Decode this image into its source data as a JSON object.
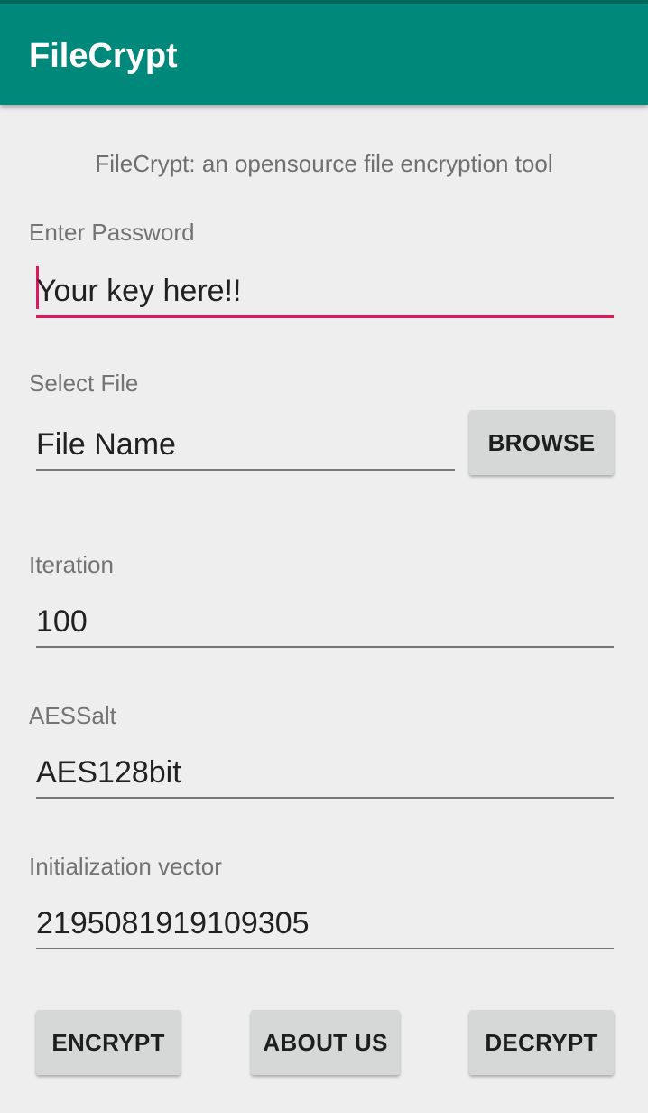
{
  "app": {
    "title": "FileCrypt",
    "subtitle": "FileCrypt: an opensource file encryption tool",
    "colors": {
      "app_bar": "#00897B",
      "status_bar": "#00695C",
      "accent": "#D81B60",
      "background": "#EEEEEE",
      "button": "#D6D7D7"
    }
  },
  "form": {
    "password": {
      "label": "Enter Password",
      "value": "Your key  here!!"
    },
    "file": {
      "label": "Select File",
      "value": "File Name",
      "browse_label": "BROWSE"
    },
    "iteration": {
      "label": "Iteration",
      "value": "100"
    },
    "aes_salt": {
      "label": "AESSalt",
      "value": "AES128bit"
    },
    "iv": {
      "label": "Initialization vector",
      "value": "2195081919109305"
    }
  },
  "actions": {
    "encrypt_label": "ENCRYPT",
    "about_label": "ABOUT US",
    "decrypt_label": "DECRYPT"
  }
}
